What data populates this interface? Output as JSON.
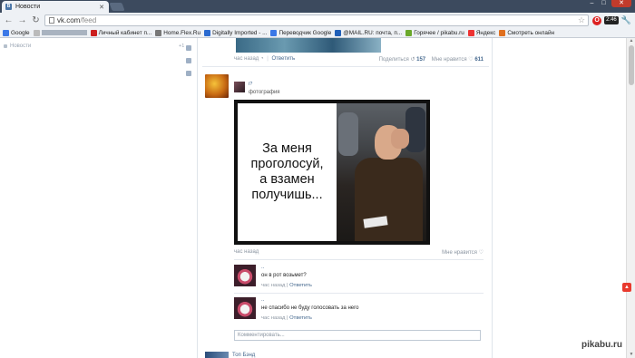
{
  "browser": {
    "tab_title": "Новости",
    "tab_favicon": "B",
    "url_host": "vk.com",
    "url_path": "/feed",
    "clock": "2:46",
    "opera_letter": "O",
    "bookmarks": [
      {
        "label": "Google",
        "icon": "google-icon",
        "color": "#3b78e7"
      },
      {
        "label": "",
        "icon": "redacted-bookmark",
        "color": "#888"
      },
      {
        "label": "Личный кабинет п...",
        "icon": "youtube-icon",
        "color": "#cc1f1f"
      },
      {
        "label": "Home.Flex.Ru",
        "icon": "home-icon",
        "color": "#777"
      },
      {
        "label": "Digitally Imported - ...",
        "icon": "di-icon",
        "color": "#2a6ad0"
      },
      {
        "label": "Переводчик Google",
        "icon": "translate-icon",
        "color": "#3b78e7"
      },
      {
        "label": "@MAIL.RU: почта, п...",
        "icon": "mail-icon",
        "color": "#1f5fb8"
      },
      {
        "label": "Горячее / pikabu.ru",
        "icon": "pikabu-icon",
        "color": "#6aa82b"
      },
      {
        "label": "Яндекс",
        "icon": "yandex-icon",
        "color": "#e33"
      },
      {
        "label": "Смотреть онлайн",
        "icon": "tv-icon",
        "color": "#e07020"
      }
    ]
  },
  "left_nav": {
    "item_label": "Новости",
    "count": "+1"
  },
  "prev_post": {
    "time": "час назад",
    "reply": "Ответить",
    "share_label": "Поделиться",
    "share_count": "157",
    "like_label": "Мне нравится",
    "like_count": "611"
  },
  "post": {
    "owner_name": "i?",
    "type": "фотография",
    "caption_lines": [
      "За меня",
      "проголосуй,",
      "а взамен",
      "получишь..."
    ],
    "time": "час назад",
    "like_label": "Мне нравится"
  },
  "comments": [
    {
      "name": "..",
      "text": "он в рот возьмет?",
      "time": "час назад",
      "reply": "Ответить"
    },
    {
      "name": "..",
      "text": "не спасибо не буду голосовать за него",
      "time": "час назад",
      "reply": "Ответить"
    }
  ],
  "comment_input": {
    "placeholder": "Комментировать..."
  },
  "next_post": {
    "title": "Топ Бэнд"
  },
  "watermark": "pikabu.ru",
  "colors": {
    "vk_blue": "#45688e",
    "chrome_frame": "#3c4a5e"
  }
}
